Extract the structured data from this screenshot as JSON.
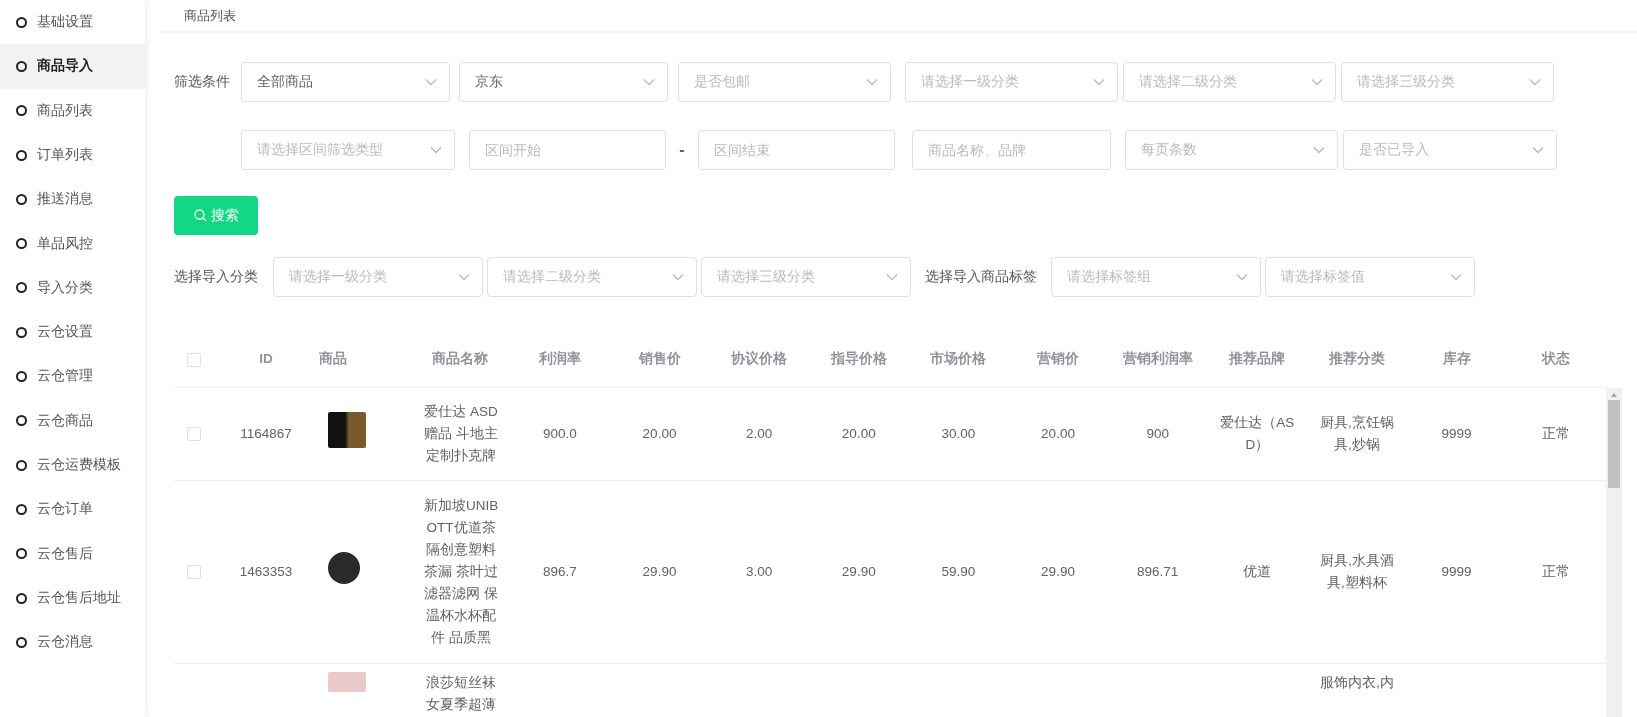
{
  "sidebar": {
    "items": [
      {
        "label": "基础设置",
        "selected": false
      },
      {
        "label": "商品导入",
        "selected": true
      },
      {
        "label": "商品列表",
        "selected": false
      },
      {
        "label": "订单列表",
        "selected": false
      },
      {
        "label": "推送消息",
        "selected": false
      },
      {
        "label": "单品风控",
        "selected": false
      },
      {
        "label": "导入分类",
        "selected": false
      },
      {
        "label": "云仓设置",
        "selected": false
      },
      {
        "label": "云仓管理",
        "selected": false
      },
      {
        "label": "云仓商品",
        "selected": false
      },
      {
        "label": "云仓运费模板",
        "selected": false
      },
      {
        "label": "云仓订单",
        "selected": false
      },
      {
        "label": "云仓售后",
        "selected": false
      },
      {
        "label": "云仓售后地址",
        "selected": false
      },
      {
        "label": "云仓消息",
        "selected": false
      }
    ]
  },
  "breadcrumb": "商品列表",
  "filters": {
    "label": "筛选条件",
    "fields": [
      {
        "kind": "select",
        "value": "全部商品"
      },
      {
        "kind": "select",
        "value": "京东"
      },
      {
        "kind": "select",
        "placeholder": "是否包邮"
      },
      {
        "kind": "select",
        "placeholder": "请选择一级分类"
      },
      {
        "kind": "select",
        "placeholder": "请选择二级分类"
      },
      {
        "kind": "select",
        "placeholder": "请选择三级分类"
      },
      {
        "kind": "select",
        "placeholder": "请选择区间筛选类型"
      },
      {
        "kind": "input",
        "placeholder": "区间开始"
      },
      {
        "kind": "dash",
        "text": "-"
      },
      {
        "kind": "input",
        "placeholder": "区间结束"
      },
      {
        "kind": "input",
        "placeholder": "商品名称、品牌"
      },
      {
        "kind": "select",
        "placeholder": "每页条数"
      },
      {
        "kind": "select",
        "placeholder": "是否已导入"
      }
    ]
  },
  "search_button": {
    "label": "搜索"
  },
  "import": {
    "label": "选择导入分类",
    "selects": [
      {
        "placeholder": "请选择一级分类"
      },
      {
        "placeholder": "请选择二级分类"
      },
      {
        "placeholder": "请选择三级分类"
      }
    ],
    "tag_label": "选择导入商品标签",
    "tag_selects": [
      {
        "placeholder": "请选择标签组"
      },
      {
        "placeholder": "请选择标签值"
      }
    ]
  },
  "table": {
    "header_checked": false,
    "columns": [
      "ID",
      "商品",
      "商品名称",
      "利润率",
      "销售价",
      "协议价格",
      "指导价格",
      "市场价格",
      "营销价",
      "营销利润率",
      "推荐品牌",
      "推荐分类",
      "库存",
      "状态"
    ],
    "rows": [
      {
        "checked": false,
        "id": "1164867",
        "name": "爱仕达 ASD 赠品 斗地主定制扑克牌",
        "profit_rate": "900.0",
        "sale_price": "20.00",
        "agreed_price": "2.00",
        "guide_price": "20.00",
        "market_price": "30.00",
        "promo_price": "20.00",
        "promo_profit_rate": "900",
        "brand": "爱仕达（ASD）",
        "category": "厨具,烹饪锅具,炒锅",
        "stock": "9999",
        "status": "正常"
      },
      {
        "checked": false,
        "id": "1463353",
        "name": "新加坡UNIBOTT优道茶隔创意塑料茶漏 茶叶过滤器滤网 保温杯水杯配件 品质黑",
        "profit_rate": "896.7",
        "sale_price": "29.90",
        "agreed_price": "3.00",
        "guide_price": "29.90",
        "market_price": "59.90",
        "promo_price": "29.90",
        "promo_profit_rate": "896.71",
        "brand": "优道",
        "category": "厨具,水具酒具,塑料杯",
        "stock": "9999",
        "status": "正常"
      },
      {
        "name": "浪莎短丝袜女夏季超薄",
        "category": "服饰内衣,内"
      }
    ]
  }
}
